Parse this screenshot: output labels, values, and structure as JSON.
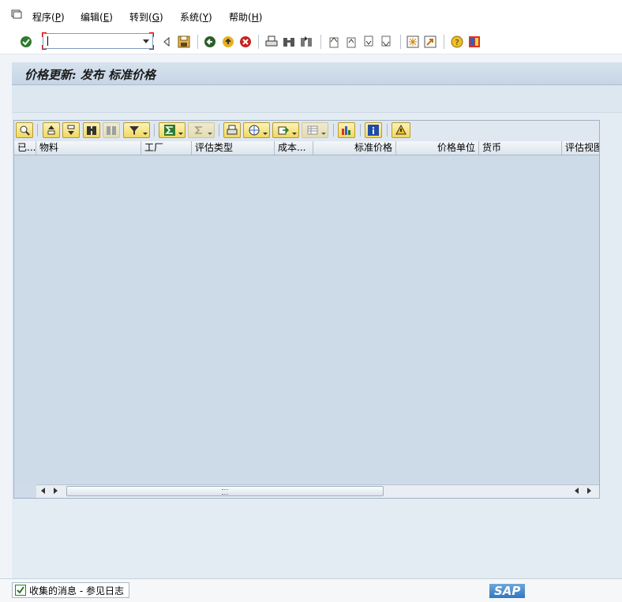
{
  "menu": {
    "items": [
      {
        "label": "程序(",
        "key": "P",
        "end": ")"
      },
      {
        "label": "编辑(",
        "key": "E",
        "end": ")"
      },
      {
        "label": "转到(",
        "key": "G",
        "end": ")"
      },
      {
        "label": "系统(",
        "key": "Y",
        "end": ")"
      },
      {
        "label": "帮助(",
        "key": "H",
        "end": ")"
      }
    ]
  },
  "command_field": {
    "value": ""
  },
  "title": "价格更新: 发布 标准价格",
  "grid": {
    "columns": [
      "已...",
      "物料",
      "工厂",
      "评估类型",
      "成本...",
      "标准价格",
      "价格单位",
      "货币",
      "评估视图"
    ]
  },
  "status": {
    "message": "收集的消息 - 参见日志"
  },
  "logo": "SAP",
  "colors": {
    "accent": "#f0d860",
    "title_bg": "#c6d5e5",
    "grid_bg": "#cddbe9"
  }
}
